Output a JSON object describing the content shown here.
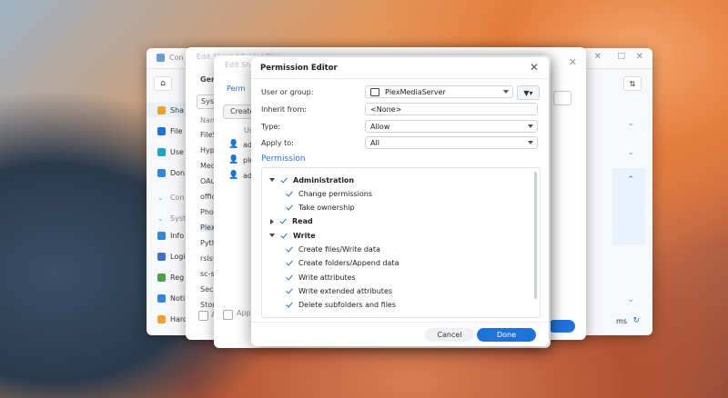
{
  "control_panel": {
    "title": "Con",
    "sidebar": [
      {
        "label": "Sha",
        "color": "#f0a030"
      },
      {
        "label": "File",
        "color": "#1f73d8"
      },
      {
        "label": "Use",
        "color": "#1aa5c9"
      },
      {
        "label": "Don",
        "color": "#2f87d8"
      },
      {
        "label": "Con",
        "color": "#999999"
      },
      {
        "label": "Syst",
        "color": "#999999"
      },
      {
        "label": "Info",
        "color": "#2f87d8"
      },
      {
        "label": "Logi",
        "color": "#3f72c4"
      },
      {
        "label": "Reg",
        "color": "#4aa14a"
      },
      {
        "label": "Noti",
        "color": "#2f87d8"
      },
      {
        "label": "Harc",
        "color": "#f0a030"
      }
    ],
    "right_button": "ms"
  },
  "edit_shared_folder": {
    "title": "Edit Shared Folder Plex",
    "tab": "Gen",
    "sys_label": "Sys",
    "name_header": "Nam",
    "list": [
      "FileS",
      "Hype",
      "Med",
      "OAu",
      "offic",
      "Phot",
      "Plex",
      "Pyth",
      "rslsy",
      "sc-s",
      "Secu",
      "Stor"
    ],
    "footer_label": "App"
  },
  "middle": {
    "title": "Edit Sh",
    "tab": "Perm",
    "create_label": "Create",
    "col_label": "Us",
    "rows": [
      "ad",
      "ple",
      "ad"
    ]
  },
  "permission_editor": {
    "title": "Permission Editor",
    "user_or_group_label": "User or group:",
    "user_or_group_value": "PlexMediaServer",
    "inherit_label": "Inherit from:",
    "inherit_value": "<None>",
    "type_label": "Type:",
    "type_value": "Allow",
    "apply_label": "Apply to:",
    "apply_value": "All",
    "permission_heading": "Permission",
    "tree": [
      {
        "label": "Administration",
        "level": 0,
        "expanded": true,
        "bold": true
      },
      {
        "label": "Change permissions",
        "level": 1
      },
      {
        "label": "Take ownership",
        "level": 1
      },
      {
        "label": "Read",
        "level": 0,
        "expanded": false,
        "bold": true
      },
      {
        "label": "Write",
        "level": 0,
        "expanded": true,
        "bold": true
      },
      {
        "label": "Create files/Write data",
        "level": 1
      },
      {
        "label": "Create folders/Append data",
        "level": 1
      },
      {
        "label": "Write attributes",
        "level": 1
      },
      {
        "label": "Write extended attributes",
        "level": 1
      },
      {
        "label": "Delete subfolders and files",
        "level": 1
      }
    ],
    "cancel_label": "Cancel",
    "done_label": "Done"
  }
}
